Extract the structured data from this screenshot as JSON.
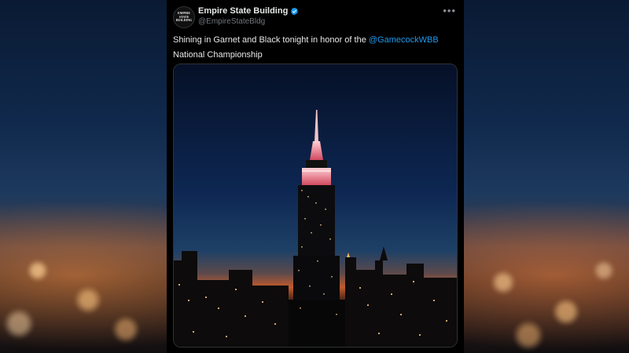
{
  "tweet": {
    "author_name": "Empire State Building",
    "author_handle": "@EmpireStateBldg",
    "avatar_text": "EMPIRE STATE BUILDING",
    "text_before": "Shining in Garnet and Black tonight in honor of the ",
    "mention": "@GamecockWBB",
    "text_after": "National Championship",
    "more_icon": "more-horizontal-icon",
    "verified_icon": "verified-badge-icon"
  },
  "colors": {
    "verified": "#1d9bf0",
    "mention": "#1d9bf0",
    "card_bg": "#000000"
  }
}
